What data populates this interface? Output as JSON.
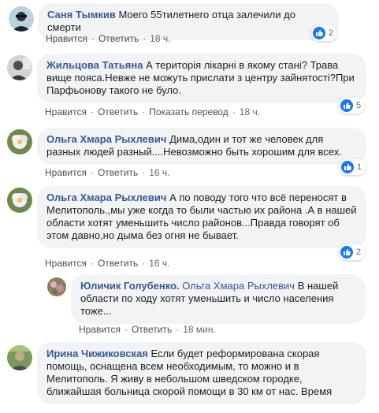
{
  "comments": [
    {
      "author": "Саня Тымкив",
      "text": "Моего 55тилетнего отца залечили до смерти",
      "actions": [
        "Нравится",
        "Ответить"
      ],
      "time": "18 ч.",
      "reactions": "2"
    },
    {
      "author": "Жильцова Татьяна",
      "text": "А територія лікарні в якому стані? Трава вище пояса.Невже не можуть прислати з центру зайнятості?При Парфьонову такого не було.",
      "actions": [
        "Нравится",
        "Ответить",
        "Показать перевод"
      ],
      "time": "18 ч.",
      "reactions": "5"
    },
    {
      "author": "Ольга Хмара Рыхлевич",
      "text": "Дима,один и тот же человек для разных людей разный....Невозможно быть хорошим для всех.",
      "actions": [
        "Нравится",
        "Ответить"
      ],
      "time": "16 ч.",
      "reactions": "1"
    },
    {
      "author": "Ольга Хмара Рыхлевич",
      "text": "А по поводу того что всё переносят в Мелитополь.,мы уже когда то были частью их района .А в нашей области хотят уменьшить число районов...Правда говорят об этом давно,но дыма без огня не бывает.",
      "actions": [
        "Нравится",
        "Ответить"
      ],
      "time": "16 ч.",
      "reactions": "2"
    },
    {
      "author": "Юличик Голубенко.",
      "mention": "Ольга Хмара Рыхлевич",
      "text": "В нашей области по ходу хотят уменьшить и число населения тоже...",
      "actions": [
        "Нравится",
        "Ответить"
      ],
      "time": "18 мин."
    },
    {
      "author": "Ирина Чижиковская",
      "text": "Если будет реформирована скорая помощь, оснащена всем необходимым, то можно и в Мелитополь. Я живу в небольшом шведском городке, ближайшая больница скорой помощи в 30 км от нас. Время"
    }
  ],
  "colors": {
    "link": "#385898",
    "bubble": "#f2f3f5",
    "like": "#1877f2"
  }
}
